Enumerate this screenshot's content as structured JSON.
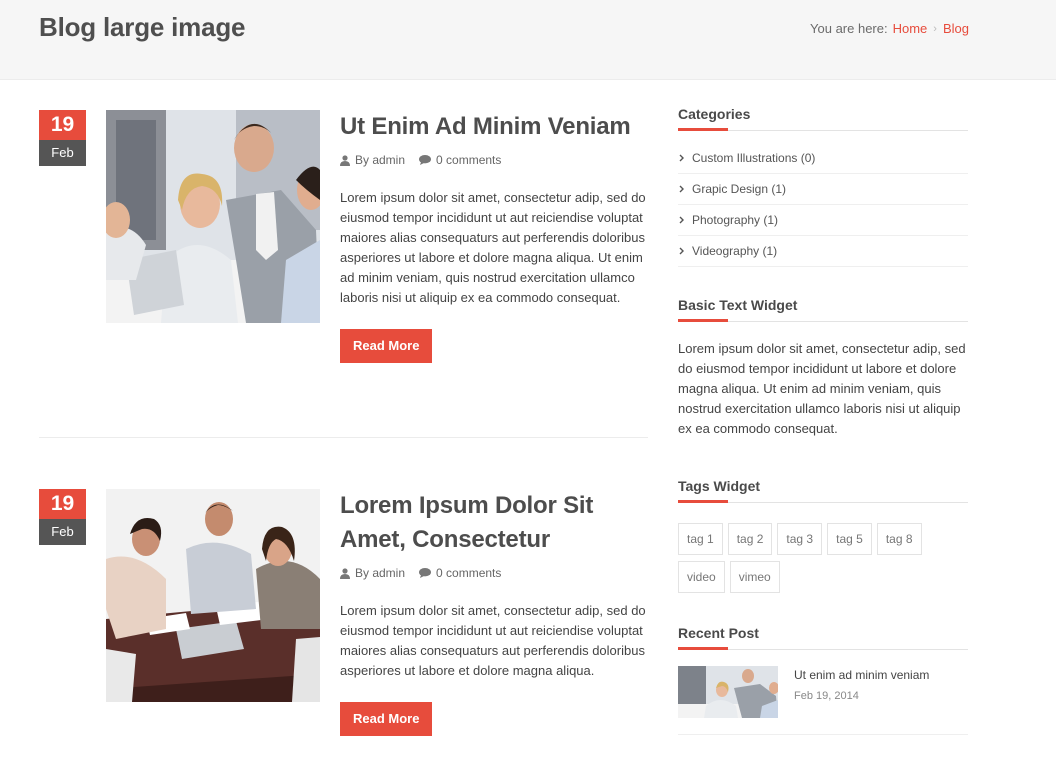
{
  "header": {
    "title": "Blog large image",
    "breadcrumb_prefix": "You are here:",
    "breadcrumb_home": "Home",
    "breadcrumb_current": "Blog"
  },
  "posts": [
    {
      "day": "19",
      "month": "Feb",
      "title": "Ut Enim Ad Minim Veniam",
      "author": "By admin",
      "comments": "0 comments",
      "excerpt": "Lorem ipsum dolor sit amet, consectetur adip, sed do eiusmod tempor incididunt ut aut reiciendise voluptat maiores alias consequaturs aut perferendis doloribus asperiores ut labore et dolore magna aliqua. Ut enim ad minim veniam, quis nostrud exercitation ullamco laboris nisi ut aliquip ex ea commodo consequat.",
      "read_more": "Read More"
    },
    {
      "day": "19",
      "month": "Feb",
      "title": "Lorem Ipsum Dolor Sit Amet, Consectetur",
      "author": "By admin",
      "comments": "0 comments",
      "excerpt": "Lorem ipsum dolor sit amet, consectetur adip, sed do eiusmod tempor incididunt ut aut reiciendise voluptat maiores alias consequaturs aut perferendis doloribus asperiores ut labore et dolore magna aliqua.",
      "read_more": "Read More"
    }
  ],
  "sidebar": {
    "categories_title": "Categories",
    "categories": [
      "Custom Illustrations (0)",
      "Grapic Design (1)",
      "Photography (1)",
      "Videography (1)"
    ],
    "text_widget_title": "Basic Text Widget",
    "text_widget_body": "Lorem ipsum dolor sit amet, consectetur adip, sed do eiusmod tempor incididunt ut labore et dolore magna aliqua. Ut enim ad minim veniam, quis nostrud exercitation ullamco laboris nisi ut aliquip ex ea commodo consequat.",
    "tags_title": "Tags Widget",
    "tags": [
      "tag 1",
      "tag 2",
      "tag 3",
      "tag 5",
      "tag 8",
      "video",
      "vimeo"
    ],
    "recent_title": "Recent Post",
    "recent_posts": [
      {
        "title": "Ut enim ad minim veniam",
        "date": "Feb 19, 2014"
      }
    ]
  },
  "colors": {
    "accent": "#e74c3c",
    "date_month_bg": "#555555",
    "header_bg": "#f6f6f6"
  },
  "icons": {
    "author": "user-icon",
    "comments": "comment-icon",
    "category": "chevron-right-icon",
    "breadcrumb_separator": "chevron-right-icon"
  }
}
